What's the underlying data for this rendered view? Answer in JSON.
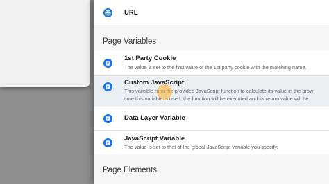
{
  "left_panel": {},
  "list": {
    "url_item": {
      "title": "URL",
      "icon": "globe-icon"
    },
    "page_variables": {
      "heading": "Page Variables",
      "items": [
        {
          "title": "1st Party Cookie",
          "desc": "The value is set to the first value of the 1st party cookie with the matching name.",
          "icon": "document-icon"
        },
        {
          "title": "Custom JavaScript",
          "desc1": "This variable runs the provided JavaScript function to calculate its value in the brow",
          "desc2": "time this variable is used, the function will be executed and its return value will be",
          "icon": "document-icon"
        },
        {
          "title": "Data Layer Variable",
          "icon": "document-icon"
        },
        {
          "title": "JavaScript Variable",
          "desc": "The value is set to that of the global JavaScript variable you specify.",
          "icon": "document-icon"
        }
      ]
    },
    "page_elements": {
      "heading": "Page Elements"
    }
  },
  "colors": {
    "accent": "#1a73e8",
    "highlight": "#eceff1",
    "cursor": "#fab43c"
  }
}
